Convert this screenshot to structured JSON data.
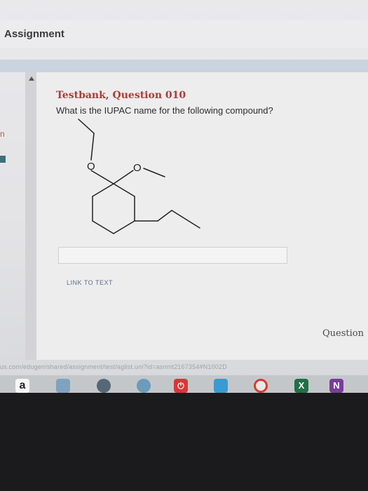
{
  "app": {
    "title": "Assignment"
  },
  "question": {
    "title": "Testbank, Question 010",
    "text": "What is the IUPAC name for the following compound?",
    "oxygen_labels": [
      "O",
      "O"
    ]
  },
  "answer": {
    "value": ""
  },
  "links": {
    "link_to_text": "LINK TO TEXT"
  },
  "side": {
    "question_label": "Question"
  },
  "status_bar": {
    "url": "us.com/edugen/shared/assignment/test/aglist.uni?id=asnmt2167354#N1002D"
  },
  "left_marks": {
    "mark1": "n"
  },
  "dock": {
    "icons": [
      {
        "name": "amazon-icon",
        "glyph": "a"
      },
      {
        "name": "finder-icon",
        "glyph": ""
      },
      {
        "name": "safari-icon",
        "glyph": ""
      },
      {
        "name": "photos-icon",
        "glyph": ""
      },
      {
        "name": "power-icon",
        "glyph": "⏻"
      },
      {
        "name": "file-icon",
        "glyph": ""
      },
      {
        "name": "chrome-icon",
        "glyph": ""
      },
      {
        "name": "excel-icon",
        "glyph": "X"
      },
      {
        "name": "onenote-icon",
        "glyph": "N"
      }
    ]
  },
  "colors": {
    "question_title": "#b23a35",
    "link": "#5e6f87"
  }
}
